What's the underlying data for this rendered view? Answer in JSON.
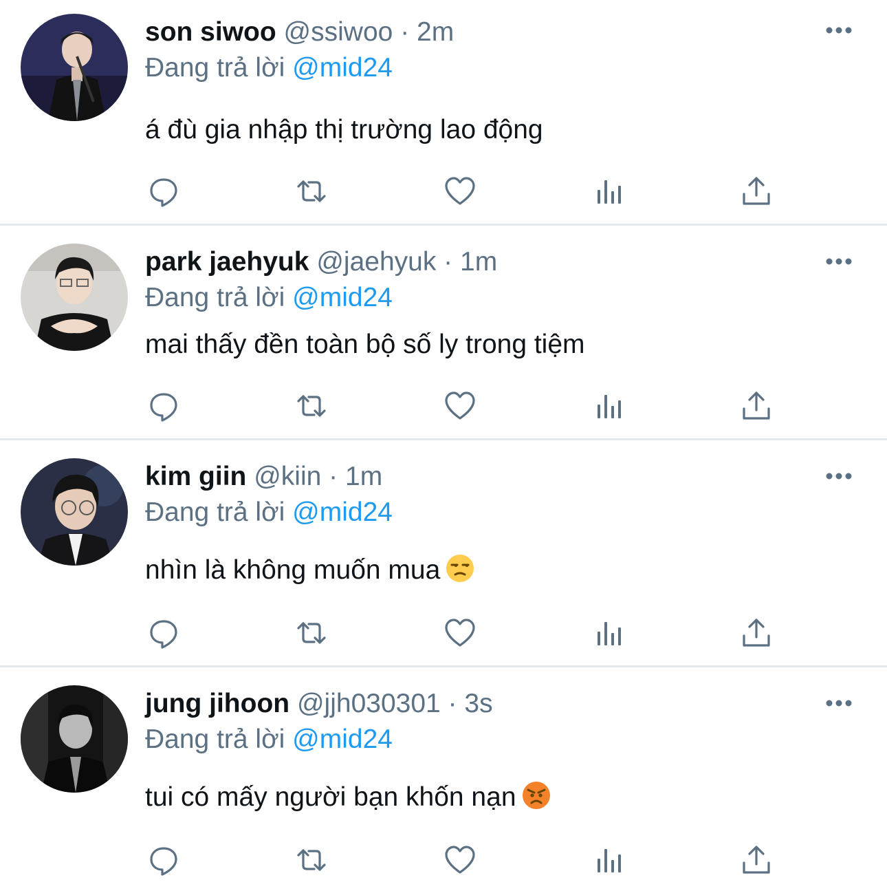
{
  "reply_prefix": "Đang trả lời",
  "colors": {
    "text": "#0f1419",
    "secondary": "#5b7083",
    "link": "#1d9bf0",
    "divider": "#e6e9ec"
  },
  "tweets": [
    {
      "name": "son siwoo",
      "handle": "@ssiwoo",
      "sep": "·",
      "time": "2m",
      "reply_to": "@mid24",
      "text": "á đù gia nhập thị trường lao động",
      "emoji": ""
    },
    {
      "name": "park jaehyuk",
      "handle": "@jaehyuk",
      "sep": "·",
      "time": "1m",
      "reply_to": "@mid24",
      "text": "mai thấy đền toàn bộ số ly trong tiệm",
      "emoji": ""
    },
    {
      "name": "kim giin",
      "handle": "@kiin",
      "sep": "·",
      "time": "1m",
      "reply_to": "@mid24",
      "text": "nhìn là không muốn mua",
      "emoji": "unamused-face-emoji"
    },
    {
      "name": "jung jihoon",
      "handle": "@jjh030301",
      "sep": "·",
      "time": "3s",
      "reply_to": "@mid24",
      "text": "tui có mấy người bạn khốn nạn",
      "emoji": "angry-face-emoji"
    }
  ]
}
